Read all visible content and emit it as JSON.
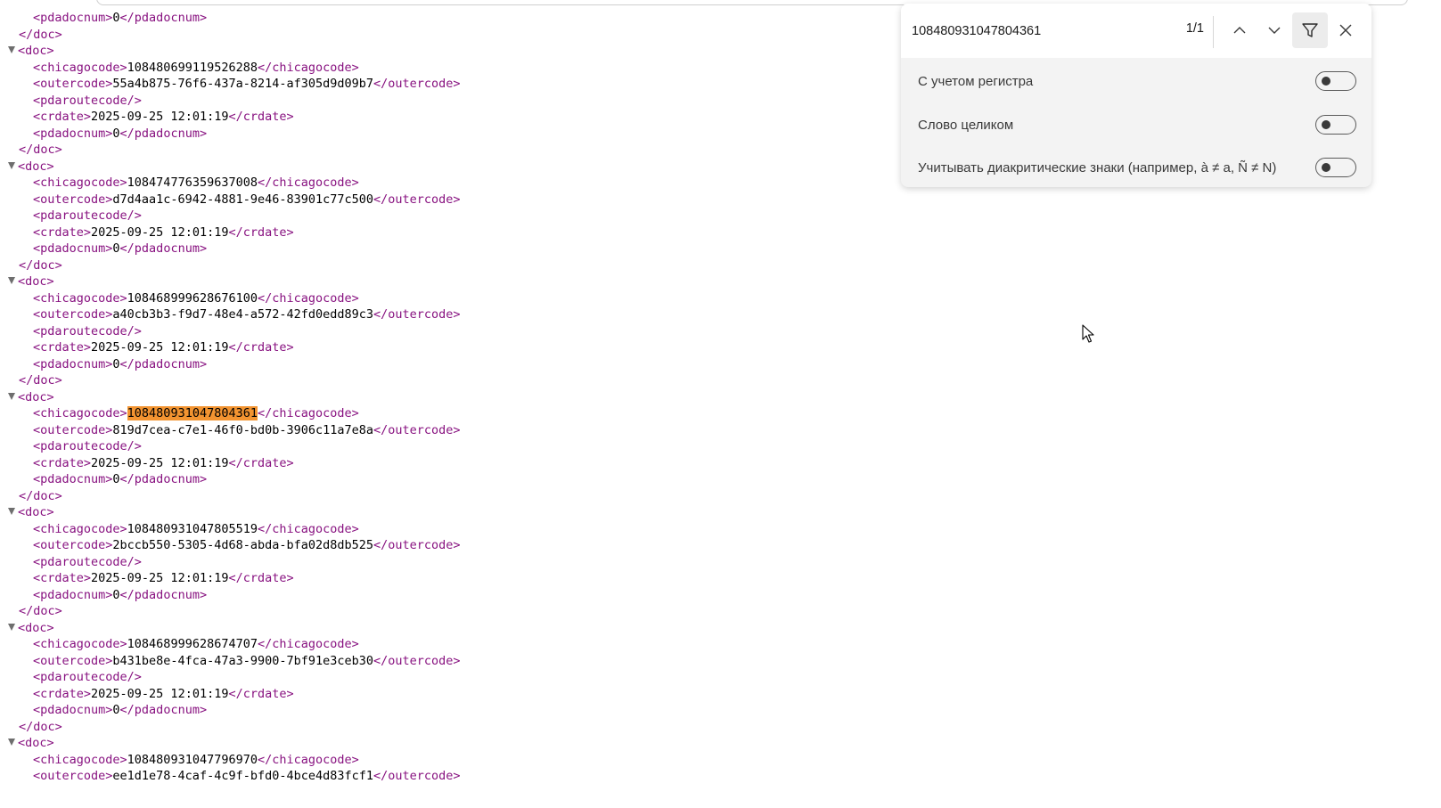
{
  "find": {
    "query": "108480931047804361",
    "count": "1/1",
    "options": [
      {
        "label": "С учетом регистра",
        "enabled": false
      },
      {
        "label": "Слово целиком",
        "enabled": false
      },
      {
        "label": "Учитывать диакритические знаки (например, à ≠ a, Ñ ≠ N)",
        "enabled": false
      }
    ]
  },
  "xml": {
    "highlight": "108480931047804361",
    "highlight_color": "#f39431",
    "tag_color": "#881280",
    "partial_first": {
      "pdadocnum": "0"
    },
    "docs": [
      {
        "chicagocode": "108480699119526288",
        "outercode": "55a4b875-76f6-437a-8214-af305d9d09b7",
        "crdate": "2025-09-25 12:01:19",
        "pdadocnum": "0"
      },
      {
        "chicagocode": "108474776359637008",
        "outercode": "d7d4aa1c-6942-4881-9e46-83901c77c500",
        "crdate": "2025-09-25 12:01:19",
        "pdadocnum": "0"
      },
      {
        "chicagocode": "108468999628676100",
        "outercode": "a40cb3b3-f9d7-48e4-a572-42fd0edd89c3",
        "crdate": "2025-09-25 12:01:19",
        "pdadocnum": "0"
      },
      {
        "chicagocode": "108480931047804361",
        "outercode": "819d7cea-c7e1-46f0-bd0b-3906c11a7e8a",
        "crdate": "2025-09-25 12:01:19",
        "pdadocnum": "0"
      },
      {
        "chicagocode": "108480931047805519",
        "outercode": "2bccb550-5305-4d68-abda-bfa02d8db525",
        "crdate": "2025-09-25 12:01:19",
        "pdadocnum": "0"
      },
      {
        "chicagocode": "108468999628674707",
        "outercode": "b431be8e-4fca-47a3-9900-7bf91e3ceb30",
        "crdate": "2025-09-25 12:01:19",
        "pdadocnum": "0"
      }
    ],
    "partial_last": {
      "chicagocode": "108480931047796970",
      "outercode": "ee1d1e78-4caf-4c9f-bfd0-4bce4d83fcf1"
    }
  }
}
